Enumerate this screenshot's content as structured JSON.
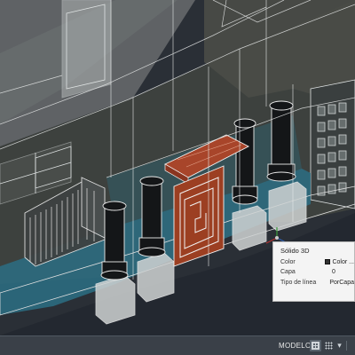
{
  "viewport": {
    "content": "3D isometric wireframe building model",
    "accent_colors": {
      "door": "#b04a2a",
      "balcony_glass": "#2a6e80",
      "wall": "#4a4d4a",
      "wire": "#e8e8e8"
    }
  },
  "tooltip": {
    "title": "Sólido 3D",
    "rows": [
      {
        "label": "Color",
        "value": "Color ..."
      },
      {
        "label": "Capa",
        "value": "0"
      },
      {
        "label": "Tipo de línea",
        "value": "PorCapa"
      }
    ]
  },
  "statusbar": {
    "model_label": "MODELO",
    "icons": [
      "grid-icon",
      "snap-icon",
      "dropdown-icon"
    ]
  },
  "ucs_icon": "ucs-axis-icon"
}
